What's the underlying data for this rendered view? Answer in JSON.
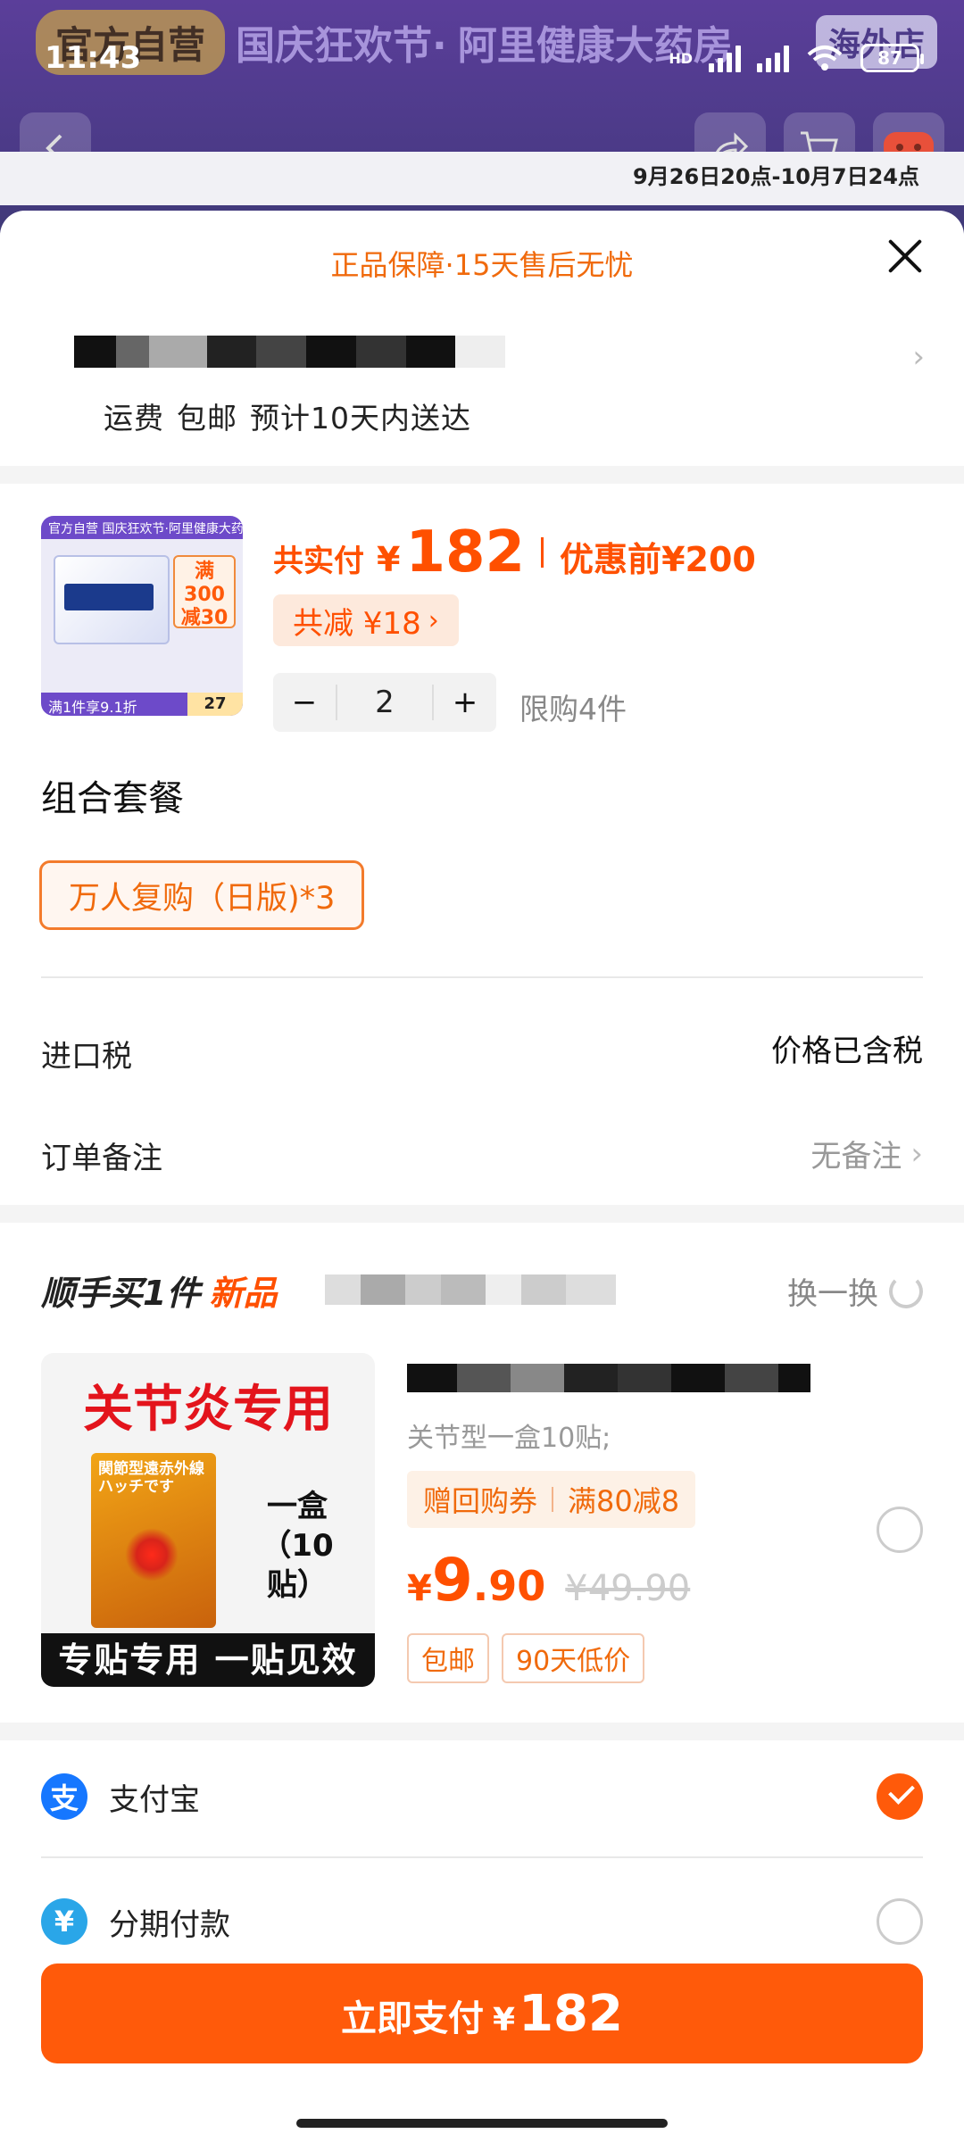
{
  "status_bar": {
    "time": "11:43",
    "network": "HD",
    "battery": "87"
  },
  "backdrop": {
    "banner_pill": "官方自营",
    "banner_text": "国庆狂欢节·",
    "banner_store": "阿里健康大药房",
    "banner_tag": "海外店",
    "promo_time": "9月26日20点-10月7日24点"
  },
  "sheet": {
    "guarantee": "正品保障·15天售后无忧",
    "shipping_fee_label": "运费",
    "shipping_fee": "包邮",
    "delivery_estimate": "预计10天内送达"
  },
  "product": {
    "thumb_head": "官方自营 国庆狂欢节·阿里健康大药房",
    "thumb_deal": "满300减30",
    "thumb_foot": "满1件享9.1折",
    "thumb_price": "27",
    "pay_label": "共实付",
    "currency": "¥",
    "pay_amount": "182",
    "before_label": "优惠前",
    "before_amount": "¥200",
    "discount": "共减 ¥18",
    "quantity": "2",
    "minus": "−",
    "plus": "+",
    "limit": "限购4件",
    "combo_title": "组合套餐",
    "combo_option": "万人复购（日版)*3",
    "tax_label": "进口税",
    "tax_value": "价格已含税",
    "note_label": "订单备注",
    "note_value": "无备注"
  },
  "addon": {
    "title": "顺手买1件",
    "title_new": "新品",
    "swap": "换一换",
    "ad_head": "关节炎专用",
    "ad_box_label": "関節型遠赤外線 ハッチです",
    "ad_qty": "一盒（10贴）",
    "ad_foot": "专贴专用 一贴见效",
    "spec": "关节型一盒10贴;",
    "coupon_left": "赠回购券",
    "coupon_right": "满80减8",
    "price_yen": "¥",
    "price_int": "9",
    "price_dec": ".90",
    "price_orig": "¥49.90",
    "tags": [
      "包邮",
      "90天低价"
    ]
  },
  "payment": {
    "methods": [
      {
        "name": "支付宝",
        "icon": "alipay-icon",
        "color": "#1677ff",
        "glyph": "支",
        "selected": true
      },
      {
        "name": "分期付款",
        "icon": "installment-icon",
        "color": "#2aa6e8",
        "glyph": "¥",
        "selected": false
      }
    ]
  },
  "bottom": {
    "pay_label": "立即支付",
    "currency": "¥",
    "pay_amount": "182"
  },
  "colors": {
    "accent": "#ff5000",
    "button": "#ff5a0a",
    "backdrop": "#4a3a86"
  }
}
